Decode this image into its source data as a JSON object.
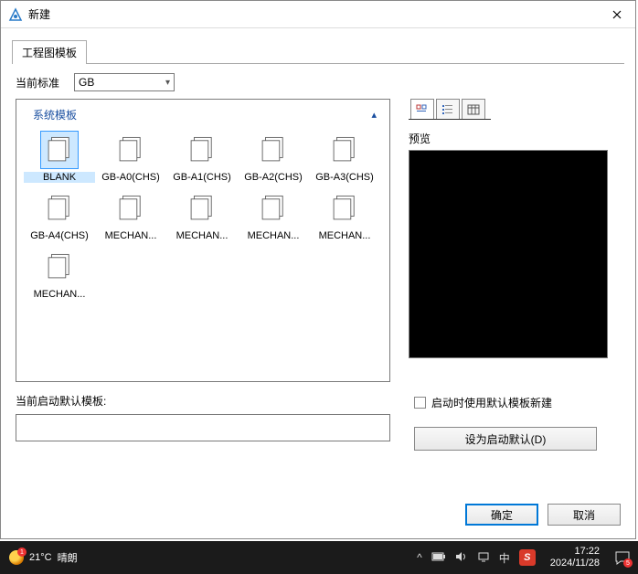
{
  "dialog": {
    "title": "新建",
    "tab_label": "工程图模板",
    "standard_label": "当前标准",
    "standard_value": "GB",
    "group_header": "系统模板",
    "templates": [
      {
        "label": "BLANK",
        "selected": true
      },
      {
        "label": "GB-A0(CHS)",
        "selected": false
      },
      {
        "label": "GB-A1(CHS)",
        "selected": false
      },
      {
        "label": "GB-A2(CHS)",
        "selected": false
      },
      {
        "label": "GB-A3(CHS)",
        "selected": false
      },
      {
        "label": "GB-A4(CHS)",
        "selected": false
      },
      {
        "label": "MECHAN...",
        "selected": false
      },
      {
        "label": "MECHAN...",
        "selected": false
      },
      {
        "label": "MECHAN...",
        "selected": false
      },
      {
        "label": "MECHAN...",
        "selected": false
      },
      {
        "label": "MECHAN...",
        "selected": false
      }
    ],
    "preview_label": "预览",
    "current_default_label": "当前启动默认模板:",
    "current_default_value": "",
    "startup_checkbox_label": "启动时使用默认模板新建",
    "set_default_btn": "设为启动默认(D)",
    "ok_btn": "确定",
    "cancel_btn": "取消",
    "view_icons": {
      "large": "large-icons-view",
      "list": "list-view",
      "detail": "detail-view"
    }
  },
  "taskbar": {
    "temp": "21°C",
    "weather": "晴朗",
    "ime": "中",
    "time": "17:22",
    "date": "2024/11/28",
    "notif_count": "5",
    "weather_badge": "1"
  }
}
